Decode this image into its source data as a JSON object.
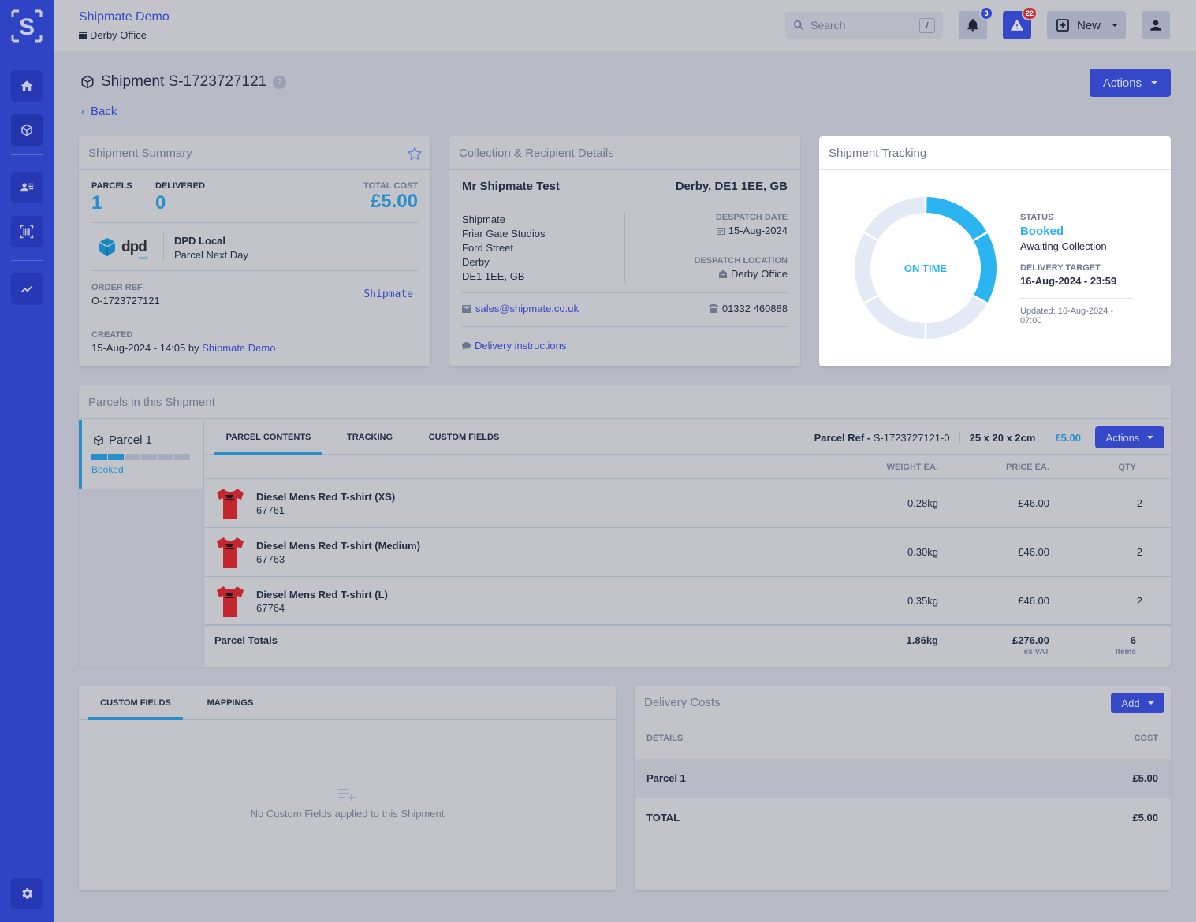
{
  "sidebar": {
    "logo": "S",
    "items": [
      {
        "name": "home",
        "icon": "home-icon"
      },
      {
        "name": "shipments",
        "icon": "box-icon",
        "active": true
      },
      {
        "name": "contacts",
        "icon": "contact-list-icon"
      },
      {
        "name": "scan",
        "icon": "barcode-icon"
      },
      {
        "name": "analytics",
        "icon": "chart-line-icon"
      },
      {
        "name": "settings",
        "icon": "gear-icon"
      }
    ]
  },
  "topbar": {
    "company": "Shipmate Demo",
    "office": "Derby Office",
    "search_placeholder": "Search",
    "search_shortcut": "/",
    "notifications_count": "3",
    "alerts_count": "22",
    "new_label": "New"
  },
  "page": {
    "title": "Shipment S-1723727121",
    "help": "?",
    "back_label": "Back",
    "actions_label": "Actions"
  },
  "summary": {
    "title": "Shipment Summary",
    "parcels_label": "PARCELS",
    "parcels_value": "1",
    "delivered_label": "DELIVERED",
    "delivered_value": "0",
    "total_cost_label": "TOTAL COST",
    "total_cost_value": "£5.00",
    "carrier_logo": "dpd",
    "carrier_logo_sub": "local",
    "carrier_name": "DPD Local",
    "carrier_service": "Parcel Next Day",
    "order_ref_label": "ORDER REF",
    "order_ref_value": "O-1723727121",
    "source_mark": "Shipmate",
    "created_label": "CREATED",
    "created_value": "15-Aug-2024 - 14:05 by",
    "created_by": "Shipmate Demo"
  },
  "recipient": {
    "title": "Collection & Recipient Details",
    "name": "Mr Shipmate Test",
    "city_line": "Derby, DE1 1EE, GB",
    "address": [
      "Shipmate",
      "Friar Gate Studios",
      "Ford Street",
      "Derby",
      "DE1 1EE, GB"
    ],
    "despatch_date_label": "DESPATCH DATE",
    "despatch_date": "15-Aug-2024",
    "despatch_location_label": "DESPATCH LOCATION",
    "despatch_location": "Derby Office",
    "email": "sales@shipmate.co.uk",
    "phone": "01332 460888",
    "instructions_label": "Delivery instructions"
  },
  "tracking": {
    "title": "Shipment Tracking",
    "center_label": "ON TIME",
    "progress_steps_total": 6,
    "progress_steps_done": 2,
    "accent": "#2ab4f0",
    "status_label": "STATUS",
    "status": "Booked",
    "status_detail": "Awaiting Collection",
    "target_label": "DELIVERY TARGET",
    "target": "16-Aug-2024 - 23:59",
    "updated": "Updated: 16-Aug-2024 - 07:00"
  },
  "parcels": {
    "title": "Parcels in this Shipment",
    "list": [
      {
        "name": "Parcel 1",
        "status": "Booked",
        "steps_total": 6,
        "steps_done": 2
      }
    ],
    "tabs": [
      "PARCEL CONTENTS",
      "TRACKING",
      "CUSTOM FIELDS"
    ],
    "active_tab": 0,
    "ref_label": "Parcel Ref -",
    "ref_value": "S-1723727121-0",
    "dimensions": "25 x 20 x 2cm",
    "cost": "£5.00",
    "actions_label": "Actions",
    "columns": {
      "weight": "WEIGHT EA.",
      "price": "PRICE EA.",
      "qty": "QTY"
    },
    "items": [
      {
        "name": "Diesel Mens Red T-shirt (XS)",
        "sku": "67761",
        "weight": "0.28kg",
        "price": "£46.00",
        "qty": "2"
      },
      {
        "name": "Diesel Mens Red T-shirt (Medium)",
        "sku": "67763",
        "weight": "0.30kg",
        "price": "£46.00",
        "qty": "2"
      },
      {
        "name": "Diesel Mens Red T-shirt (L)",
        "sku": "67764",
        "weight": "0.35kg",
        "price": "£46.00",
        "qty": "2"
      }
    ],
    "totals": {
      "label": "Parcel Totals",
      "weight": "1.86kg",
      "price": "£276.00",
      "price_note": "ex VAT",
      "qty": "6",
      "qty_note": "Items"
    }
  },
  "custom_fields": {
    "tabs": [
      "CUSTOM FIELDS",
      "MAPPINGS"
    ],
    "active_tab": 0,
    "empty_message": "No Custom Fields applied to this Shipment"
  },
  "delivery_costs": {
    "title": "Delivery Costs",
    "add_label": "Add",
    "col_details": "DETAILS",
    "col_cost": "COST",
    "rows": [
      {
        "details": "Parcel 1",
        "cost": "£5.00"
      }
    ],
    "total_label": "TOTAL",
    "total_value": "£5.00"
  }
}
